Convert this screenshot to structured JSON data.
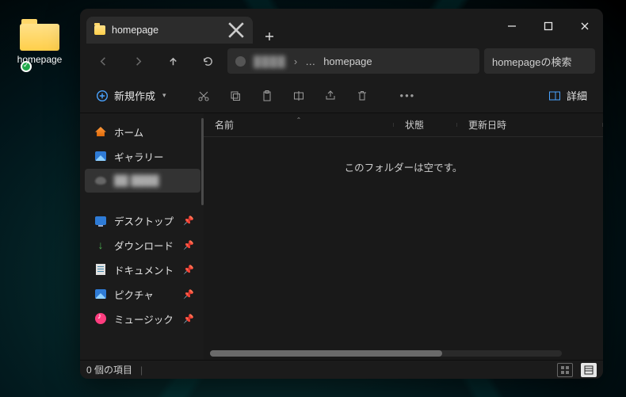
{
  "desktop": {
    "folder_label": "homepage"
  },
  "window": {
    "tabs": [
      {
        "label": "homepage"
      }
    ],
    "address": {
      "obscured_segment": "████",
      "current": "homepage"
    },
    "search_placeholder": "homepageの検索",
    "toolbar": {
      "new_label": "新規作成",
      "details_label": "詳細"
    },
    "sidebar": {
      "items": [
        {
          "key": "home",
          "label": "ホーム"
        },
        {
          "key": "gallery",
          "label": "ギャラリー"
        },
        {
          "key": "obscured",
          "label": "██ ████"
        },
        {
          "key": "desktop",
          "label": "デスクトップ",
          "pinned": true
        },
        {
          "key": "downloads",
          "label": "ダウンロード",
          "pinned": true
        },
        {
          "key": "documents",
          "label": "ドキュメント",
          "pinned": true
        },
        {
          "key": "pictures",
          "label": "ピクチャ",
          "pinned": true
        },
        {
          "key": "music",
          "label": "ミュージック",
          "pinned": true
        }
      ]
    },
    "columns": {
      "name": "名前",
      "state": "状態",
      "modified": "更新日時"
    },
    "empty_message": "このフォルダーは空です。",
    "status": {
      "item_count_text": "0 個の項目"
    }
  }
}
